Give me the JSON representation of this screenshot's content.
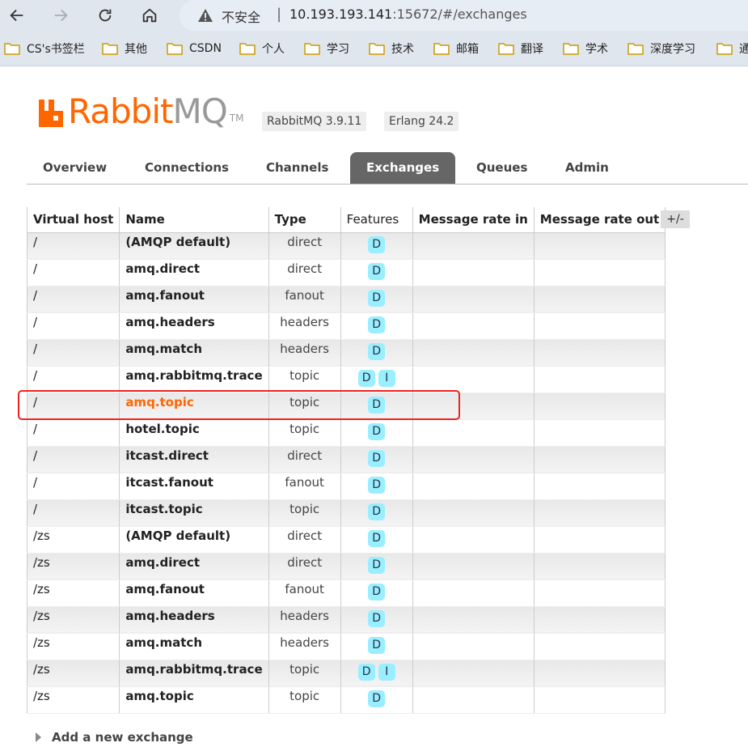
{
  "browser": {
    "security_label": "不安全",
    "url_host": "10.193.193.141",
    "url_rest": ":15672/#/exchanges",
    "bookmarks": [
      "CS's书签栏",
      "其他",
      "CSDN",
      "个人",
      "学习",
      "技术",
      "邮箱",
      "翻译",
      "学术",
      "深度学习",
      "通"
    ]
  },
  "header": {
    "logo_rabbit": "Rabbit",
    "logo_mq": "MQ",
    "logo_tm": "TM",
    "rabbitmq_version": "RabbitMQ 3.9.11",
    "erlang_version": "Erlang 24.2"
  },
  "tabs": [
    "Overview",
    "Connections",
    "Channels",
    "Exchanges",
    "Queues",
    "Admin"
  ],
  "active_tab": "Exchanges",
  "table": {
    "columns": [
      "Virtual host",
      "Name",
      "Type",
      "Features",
      "Message rate in",
      "Message rate out"
    ],
    "column_toggle": "+/-",
    "rows": [
      {
        "vhost": "/",
        "name": "(AMQP default)",
        "type": "direct",
        "features": [
          "D"
        ]
      },
      {
        "vhost": "/",
        "name": "amq.direct",
        "type": "direct",
        "features": [
          "D"
        ]
      },
      {
        "vhost": "/",
        "name": "amq.fanout",
        "type": "fanout",
        "features": [
          "D"
        ]
      },
      {
        "vhost": "/",
        "name": "amq.headers",
        "type": "headers",
        "features": [
          "D"
        ]
      },
      {
        "vhost": "/",
        "name": "amq.match",
        "type": "headers",
        "features": [
          "D"
        ]
      },
      {
        "vhost": "/",
        "name": "amq.rabbitmq.trace",
        "type": "topic",
        "features": [
          "D",
          "I"
        ]
      },
      {
        "vhost": "/",
        "name": "amq.topic",
        "type": "topic",
        "features": [
          "D"
        ],
        "highlighted": true
      },
      {
        "vhost": "/",
        "name": "hotel.topic",
        "type": "topic",
        "features": [
          "D"
        ]
      },
      {
        "vhost": "/",
        "name": "itcast.direct",
        "type": "direct",
        "features": [
          "D"
        ]
      },
      {
        "vhost": "/",
        "name": "itcast.fanout",
        "type": "fanout",
        "features": [
          "D"
        ]
      },
      {
        "vhost": "/",
        "name": "itcast.topic",
        "type": "topic",
        "features": [
          "D"
        ]
      },
      {
        "vhost": "/zs",
        "name": "(AMQP default)",
        "type": "direct",
        "features": [
          "D"
        ]
      },
      {
        "vhost": "/zs",
        "name": "amq.direct",
        "type": "direct",
        "features": [
          "D"
        ]
      },
      {
        "vhost": "/zs",
        "name": "amq.fanout",
        "type": "fanout",
        "features": [
          "D"
        ]
      },
      {
        "vhost": "/zs",
        "name": "amq.headers",
        "type": "headers",
        "features": [
          "D"
        ]
      },
      {
        "vhost": "/zs",
        "name": "amq.match",
        "type": "headers",
        "features": [
          "D"
        ]
      },
      {
        "vhost": "/zs",
        "name": "amq.rabbitmq.trace",
        "type": "topic",
        "features": [
          "D",
          "I"
        ]
      },
      {
        "vhost": "/zs",
        "name": "amq.topic",
        "type": "topic",
        "features": [
          "D"
        ]
      }
    ]
  },
  "add_exchange_label": "Add a new exchange",
  "colors": {
    "brand_orange": "#ff6600",
    "annotation_red": "#ee2222",
    "feature_badge": "#99eeff"
  }
}
